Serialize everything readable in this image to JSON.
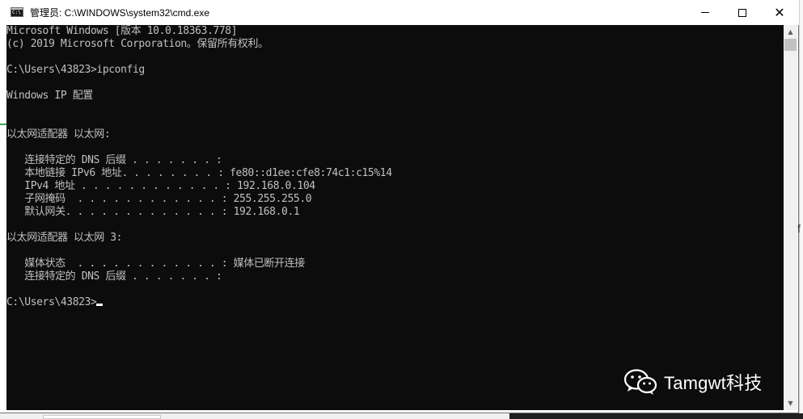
{
  "window": {
    "title": "管理员: C:\\WINDOWS\\system32\\cmd.exe",
    "controls": {
      "minimize": "minimize",
      "maximize": "maximize",
      "close": "✕"
    }
  },
  "console": {
    "lines": [
      "Microsoft Windows [版本 10.0.18363.778]",
      "(c) 2019 Microsoft Corporation。保留所有权利。",
      "",
      "C:\\Users\\43823>ipconfig",
      "",
      "Windows IP 配置",
      "",
      "",
      "以太网适配器 以太网:",
      "",
      "   连接特定的 DNS 后缀 . . . . . . . :",
      "   本地链接 IPv6 地址. . . . . . . . : fe80::d1ee:cfe8:74c1:c15%14",
      "   IPv4 地址 . . . . . . . . . . . . : 192.168.0.104",
      "   子网掩码  . . . . . . . . . . . . : 255.255.255.0",
      "   默认网关. . . . . . . . . . . . . : 192.168.0.1",
      "",
      "以太网适配器 以太网 3:",
      "",
      "   媒体状态  . . . . . . . . . . . . : 媒体已断开连接",
      "   连接特定的 DNS 后缀 . . . . . . . :",
      "",
      "C:\\Users\\43823>"
    ],
    "colors": {
      "background": "#0c0c0c",
      "foreground": "#c0c0c0",
      "cursor": "#ffffff"
    }
  },
  "watermark": {
    "text": "Tamgwt科技",
    "icon": "wechat-icon"
  },
  "background_window": {
    "edge_char": "f"
  },
  "icons": {
    "app": "cmd-icon",
    "scroll_up": "scroll-up-arrow-icon",
    "scroll_down": "scroll-down-arrow-icon"
  }
}
